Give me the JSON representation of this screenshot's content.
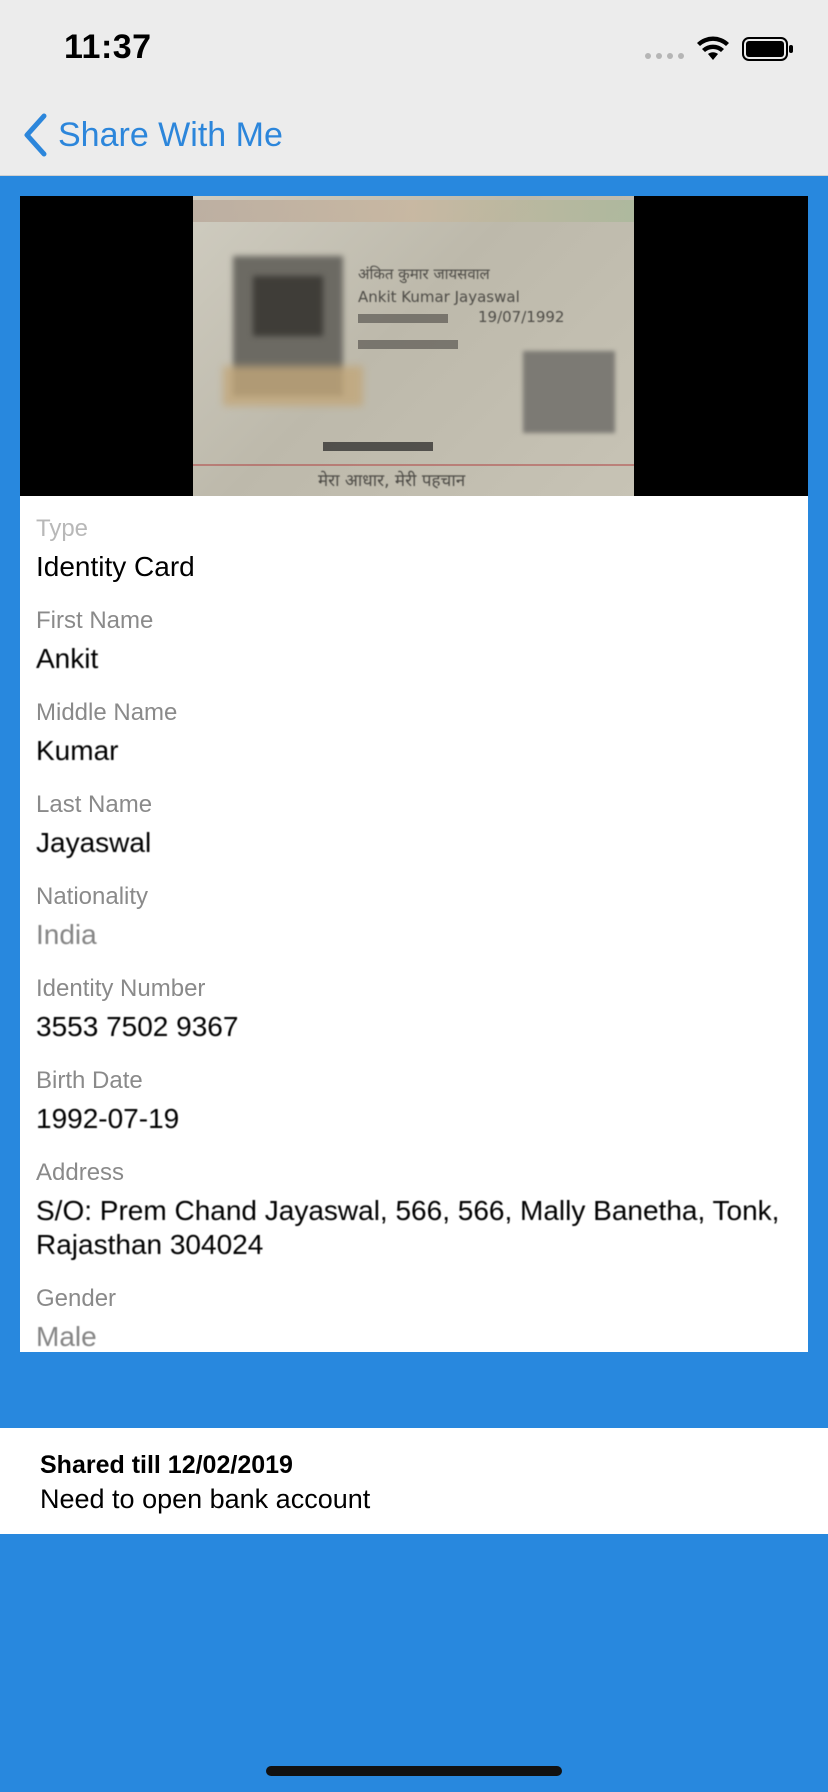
{
  "status": {
    "time": "11:37"
  },
  "nav": {
    "back_label": "Share With Me"
  },
  "photo": {
    "hindi_name": "अंकित कुमार जायसवाल",
    "name": "Ankit Kumar Jayaswal",
    "dob": "19/07/1992",
    "footer": "मेरा आधार, मेरी पहचान"
  },
  "fields": [
    {
      "label": "Type",
      "value": "Identity Card"
    },
    {
      "label": "First Name",
      "value": "Ankit"
    },
    {
      "label": "Middle Name",
      "value": "Kumar"
    },
    {
      "label": "Last Name",
      "value": "Jayaswal"
    },
    {
      "label": "Nationality",
      "value": "India"
    },
    {
      "label": "Identity Number",
      "value": "3553 7502 9367"
    },
    {
      "label": "Birth Date",
      "value": "1992-07-19"
    },
    {
      "label": "Address",
      "value": "S/O: Prem Chand Jayaswal, 566, 566, Mally Banetha, Tonk, Rajasthan 304024"
    },
    {
      "label": "Gender",
      "value": "Male"
    }
  ],
  "share": {
    "till": "Shared till 12/02/2019",
    "reason": "Need to open bank account"
  }
}
